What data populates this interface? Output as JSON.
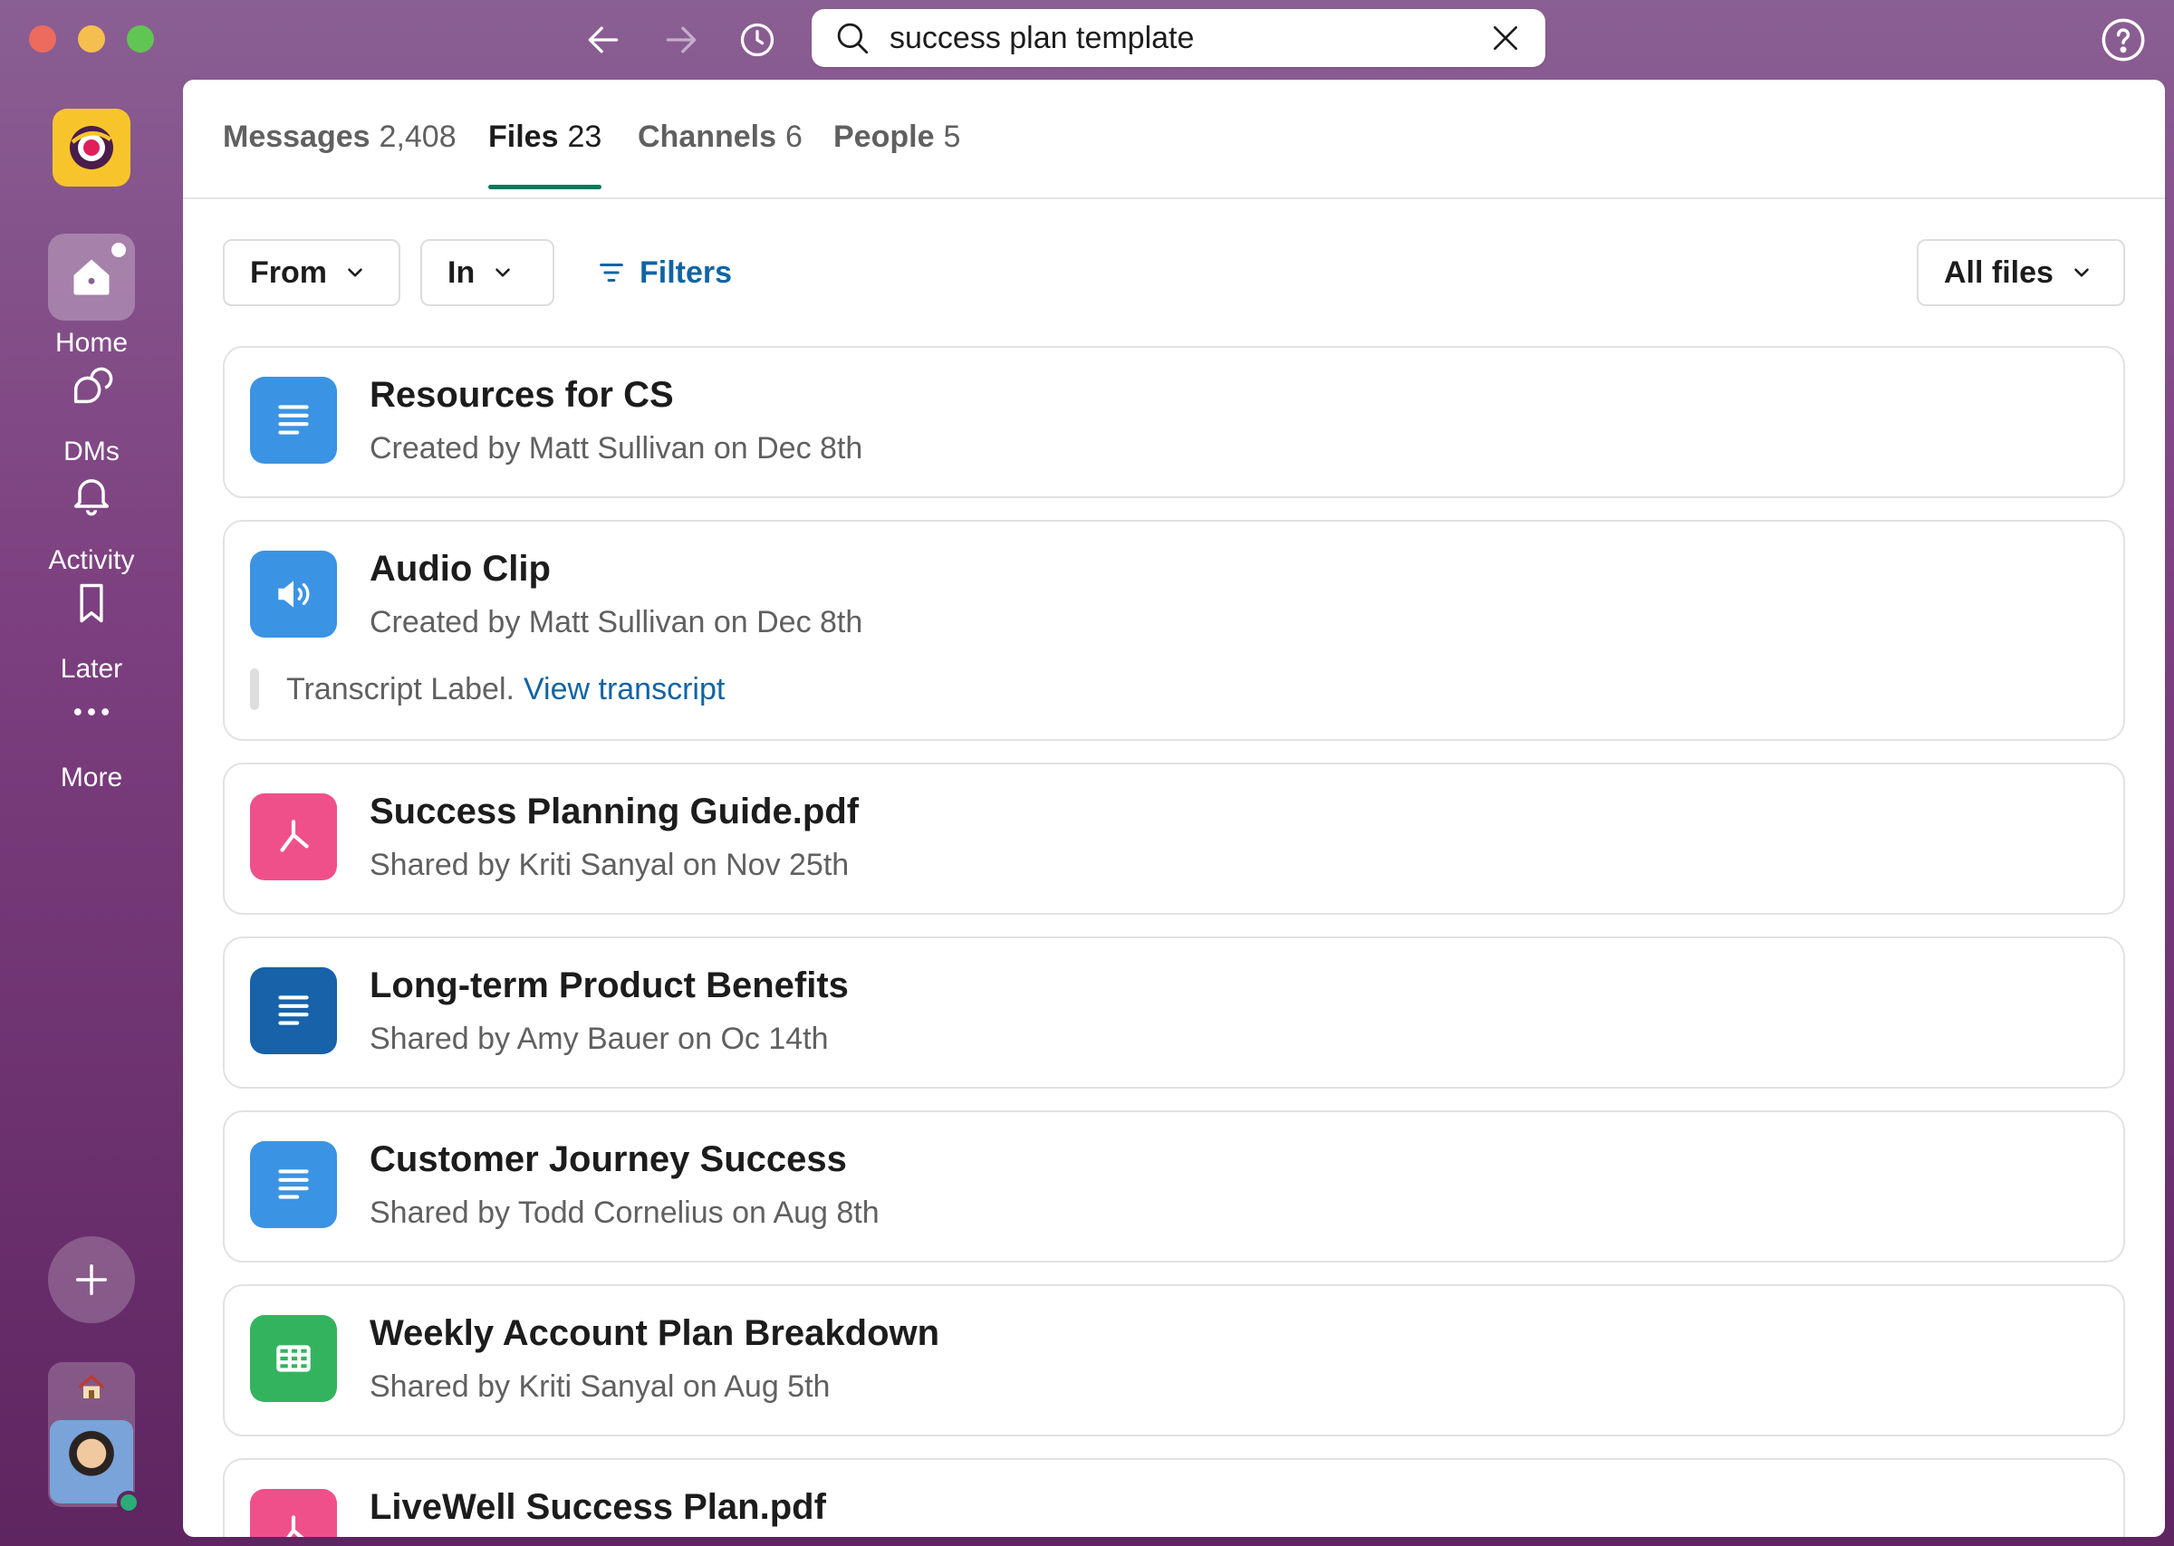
{
  "search": {
    "query": "success plan template"
  },
  "rail": {
    "items": [
      {
        "label": "Home",
        "icon": "home-icon"
      },
      {
        "label": "DMs",
        "icon": "dms-icon"
      },
      {
        "label": "Activity",
        "icon": "bell-icon"
      },
      {
        "label": "Later",
        "icon": "bookmark-icon"
      },
      {
        "label": "More",
        "icon": "more-icon"
      }
    ]
  },
  "tabs": [
    {
      "label": "Messages",
      "count": "2,408"
    },
    {
      "label": "Files",
      "count": "23"
    },
    {
      "label": "Channels",
      "count": "6"
    },
    {
      "label": "People",
      "count": "5"
    }
  ],
  "filters": {
    "from_label": "From",
    "in_label": "In",
    "filters_label": "Filters",
    "all_files_label": "All files"
  },
  "files": [
    {
      "title": "Resources for CS",
      "subtitle": "Created by Matt Sullivan on Dec 8th",
      "icon": "document-icon",
      "color": "#3b93e3"
    },
    {
      "title": "Audio Clip",
      "subtitle": "Created by Matt Sullivan on Dec 8th",
      "icon": "speaker-icon",
      "color": "#3b93e3",
      "transcript_label": "Transcript Label.",
      "transcript_link": "View transcript"
    },
    {
      "title": "Success Planning Guide.pdf",
      "subtitle": "Shared by Kriti Sanyal on Nov 25th",
      "icon": "pdf-icon",
      "color": "#f0508a"
    },
    {
      "title": "Long-term Product Benefits",
      "subtitle": "Shared by Amy Bauer on Oc 14th",
      "icon": "document-icon",
      "color": "#1762a8"
    },
    {
      "title": "Customer Journey Success",
      "subtitle": "Shared by Todd Cornelius on Aug 8th",
      "icon": "document-icon",
      "color": "#3b93e3"
    },
    {
      "title": "Weekly Account Plan Breakdown",
      "subtitle": "Shared by Kriti Sanyal on Aug 5th",
      "icon": "spreadsheet-icon",
      "color": "#34b35f"
    },
    {
      "title": "LiveWell Success Plan.pdf",
      "subtitle": "",
      "icon": "pdf-icon",
      "color": "#f0508a"
    }
  ]
}
